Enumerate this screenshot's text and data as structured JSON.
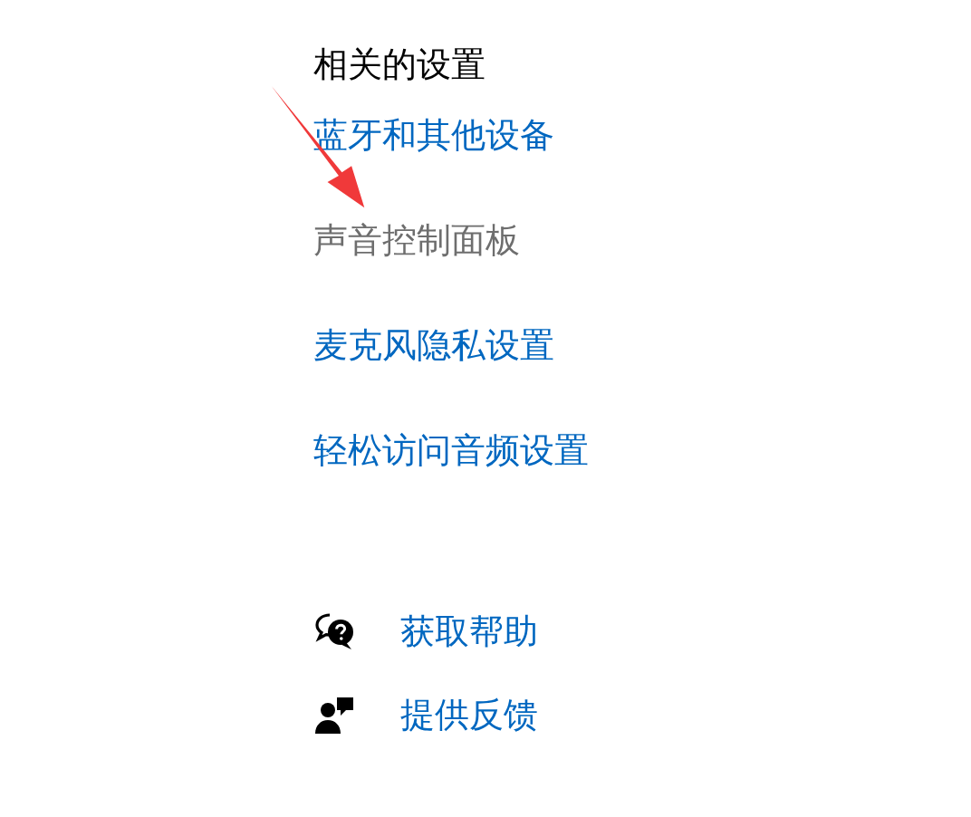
{
  "related_settings": {
    "title": "相关的设置",
    "links": [
      {
        "label": "蓝牙和其他设备",
        "disabled": false
      },
      {
        "label": "声音控制面板",
        "disabled": true
      },
      {
        "label": "麦克风隐私设置",
        "disabled": false
      },
      {
        "label": "轻松访问音频设置",
        "disabled": false
      }
    ]
  },
  "help_links": [
    {
      "kind": "help",
      "label": "获取帮助"
    },
    {
      "kind": "feedback",
      "label": "提供反馈"
    }
  ]
}
